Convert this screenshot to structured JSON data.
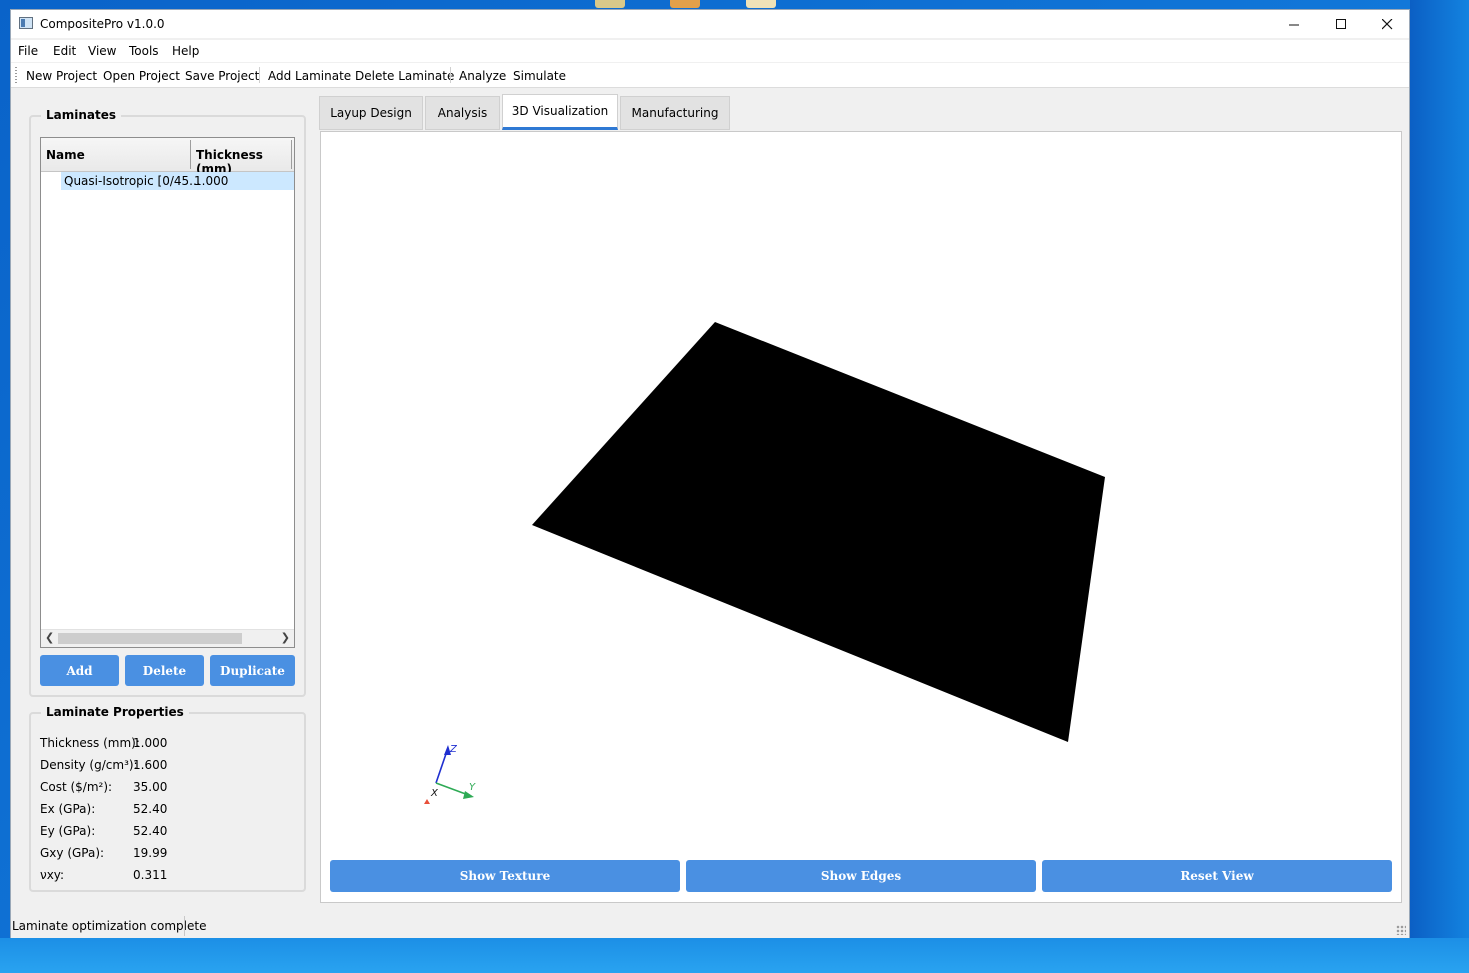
{
  "window": {
    "title": "CompositePro v1.0.0"
  },
  "menu": [
    "File",
    "Edit",
    "View",
    "Tools",
    "Help"
  ],
  "toolbar": [
    "New Project",
    "Open Project",
    "Save Project",
    "Add Laminate",
    "Delete Laminate",
    "Analyze",
    "Simulate"
  ],
  "laminates": {
    "title": "Laminates",
    "columns": [
      "Name",
      "Thickness (mm)"
    ],
    "rows": [
      {
        "name": "Quasi-Isotropic [0/45...",
        "thickness": "1.000"
      }
    ],
    "buttons": {
      "add": "Add",
      "delete": "Delete",
      "duplicate": "Duplicate"
    }
  },
  "properties": {
    "title": "Laminate Properties",
    "items": [
      {
        "label": "Thickness (mm):",
        "value": "1.000"
      },
      {
        "label": "Density (g/cm³):",
        "value": "1.600"
      },
      {
        "label": "Cost ($/m²):",
        "value": "35.00"
      },
      {
        "label": "Ex (GPa):",
        "value": "52.40"
      },
      {
        "label": "Ey (GPa):",
        "value": "52.40"
      },
      {
        "label": "Gxy (GPa):",
        "value": "19.99"
      },
      {
        "label": "νxy:",
        "value": "0.311"
      }
    ]
  },
  "tabs": [
    "Layup Design",
    "Analysis",
    "3D Visualization",
    "Manufacturing"
  ],
  "active_tab": "3D Visualization",
  "viewer": {
    "axes": {
      "x": "X",
      "y": "Y",
      "z": "Z"
    },
    "axis_colors": {
      "x": "#e8503a",
      "y": "#2eaa55",
      "z": "#1f2fd0"
    },
    "buttons": {
      "texture": "Show Texture",
      "edges": "Show Edges",
      "reset": "Reset View"
    }
  },
  "status": "Laminate optimization complete",
  "colors": {
    "accent": "#4a90e2",
    "selection": "#cce8ff",
    "tab_indicator": "#2f79d4"
  }
}
